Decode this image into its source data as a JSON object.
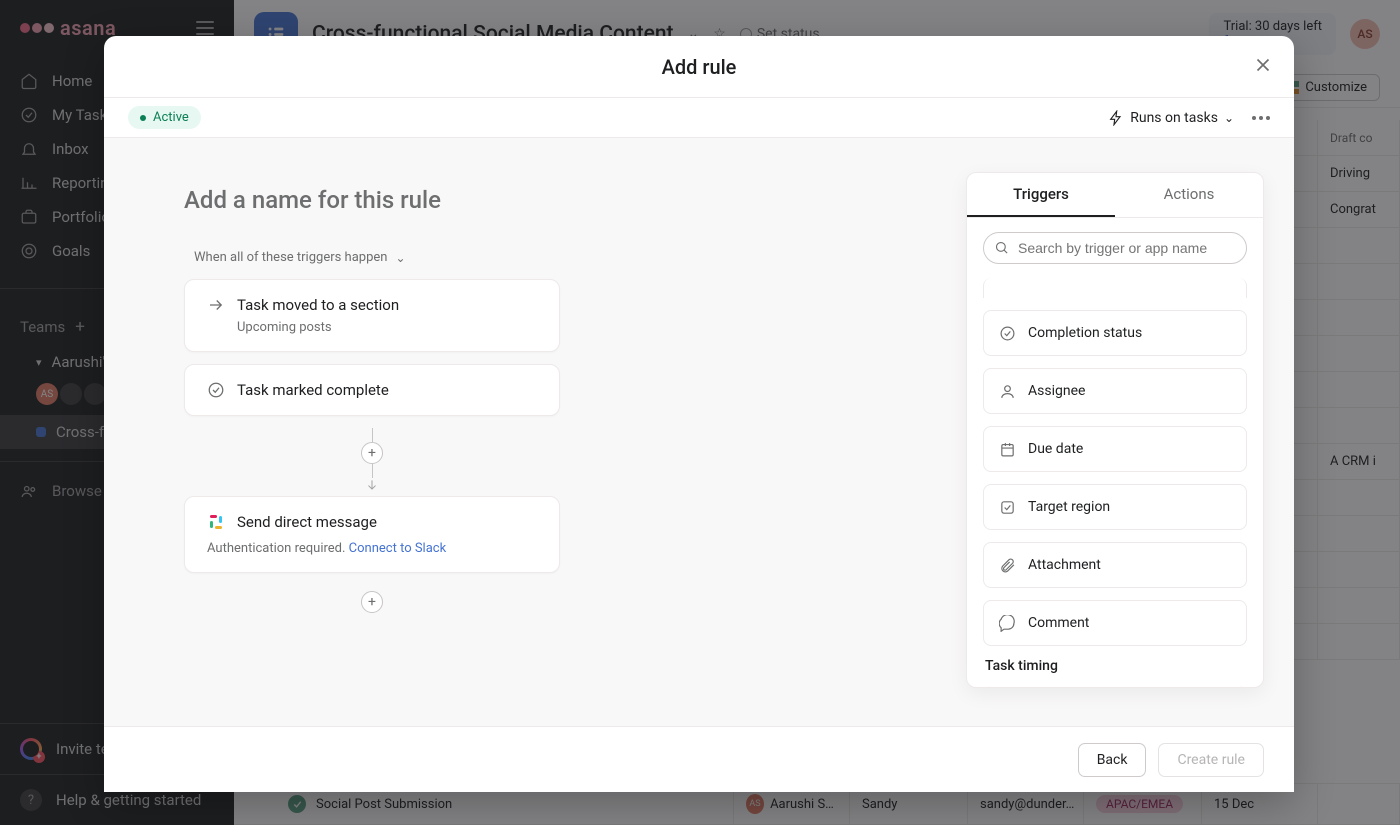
{
  "brand": "asana",
  "nav": {
    "home": "Home",
    "mytasks": "My Tasks",
    "inbox": "Inbox",
    "reporting": "Reporting",
    "portfolios": "Portfolios",
    "goals": "Goals"
  },
  "teams": {
    "header": "Teams",
    "team1": "Aarushi's",
    "project1": "Cross-fun",
    "browse": "Browse t"
  },
  "sidebar_footer": {
    "invite": "Invite te",
    "help": "Help & getting started"
  },
  "topbar": {
    "title": "Cross-functional Social Media Content",
    "set_status": "Set status",
    "trial_l1": "Trial: 30 days left",
    "trial_l2": "fo",
    "avatar": "AS",
    "customize": "Customize"
  },
  "bg_cols": {
    "c6": "Draft co"
  },
  "bg_rows": [
    {
      "desc": "Driving"
    },
    {
      "desc": "Congrat"
    },
    {
      "desc": ""
    },
    {
      "desc": ""
    },
    {
      "desc": ""
    },
    {
      "desc": ""
    },
    {
      "desc": ""
    },
    {
      "desc": ""
    },
    {
      "desc": "A CRM i"
    },
    {
      "desc": ""
    },
    {
      "desc": ""
    },
    {
      "desc": ""
    },
    {
      "desc": ""
    },
    {
      "desc": ""
    }
  ],
  "bottom_task": {
    "name": "Social Post Submission",
    "assignee": "Aarushi Sin…",
    "assignee_initials": "AS",
    "col2": "Sandy",
    "email": "sandy@dunder…",
    "region": "APAC/EMEA",
    "due": "15 Dec"
  },
  "modal": {
    "title": "Add rule",
    "status": "Active",
    "runs_on": "Runs on tasks",
    "rule_name_placeholder": "Add a name for this rule",
    "when_line": "When all of these triggers happen",
    "trigger1": {
      "title": "Task moved to a section",
      "sub": "Upcoming posts"
    },
    "trigger2": {
      "title": "Task marked complete"
    },
    "action1": {
      "title": "Send direct message",
      "auth_prefix": "Authentication required. ",
      "auth_link": "Connect to Slack"
    },
    "tabs": {
      "triggers": "Triggers",
      "actions": "Actions"
    },
    "search_placeholder": "Search by trigger or app name",
    "opts": {
      "completion": "Completion status",
      "assignee": "Assignee",
      "due": "Due date",
      "target": "Target region",
      "attachment": "Attachment",
      "comment": "Comment"
    },
    "section_timing": "Task timing",
    "back": "Back",
    "create": "Create rule"
  }
}
